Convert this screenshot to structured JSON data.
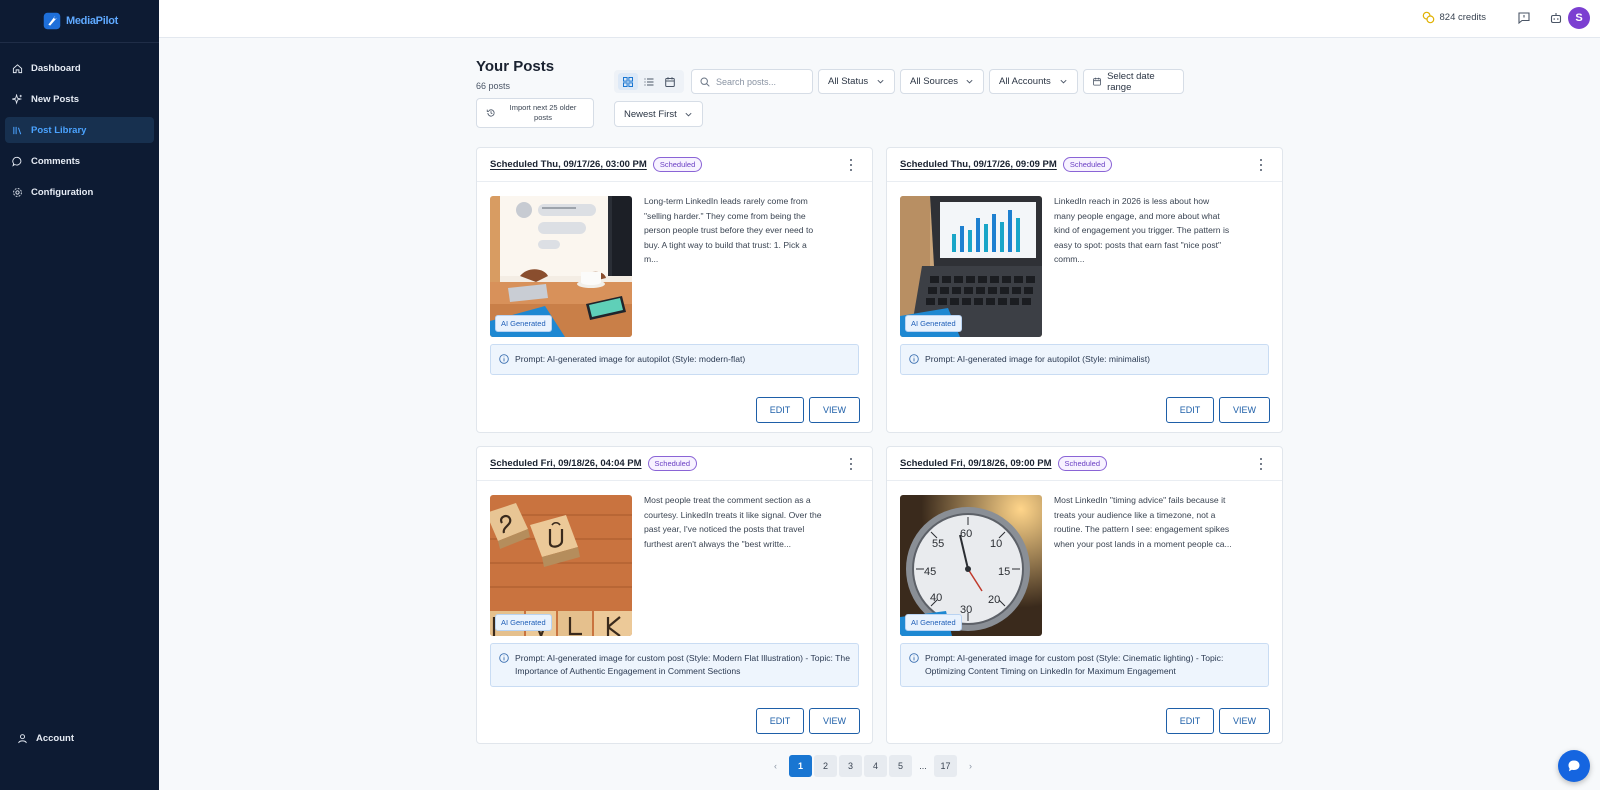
{
  "app": {
    "name": "MediaPilot",
    "accent": "#1976d2",
    "sidebar_bg": "#0d1b33"
  },
  "sidebar": {
    "items": [
      {
        "label": "Dashboard",
        "icon": "home-icon"
      },
      {
        "label": "New Posts",
        "icon": "sparkles-icon"
      },
      {
        "label": "Post Library",
        "icon": "library-icon",
        "active": true
      },
      {
        "label": "Comments",
        "icon": "comment-icon"
      },
      {
        "label": "Configuration",
        "icon": "gear-icon"
      }
    ],
    "account_label": "Account"
  },
  "topbar": {
    "credits": "824 credits",
    "avatar_initial": "S"
  },
  "header": {
    "title": "Your Posts",
    "count": "66 posts",
    "import_label": "Import next 25 older posts",
    "search_placeholder": "Search posts...",
    "status_filter": "All Status",
    "sources_filter": "All Sources",
    "accounts_filter": "All Accounts",
    "date_range": "Select date range",
    "sort": "Newest First"
  },
  "posts": [
    {
      "schedule": "Scheduled Thu, 09/17/26, 03:00 PM",
      "status": "Scheduled",
      "ai_badge": "AI Generated",
      "text": "Long-term LinkedIn leads rarely come from \"selling harder.\" They come from being the person people trust before they ever need to buy. A tight way to build that trust: 1. Pick a m...",
      "prompt": "Prompt: AI-generated image for autopilot (Style: modern-flat)",
      "edit": "EDIT",
      "view": "VIEW"
    },
    {
      "schedule": "Scheduled Thu, 09/17/26, 09:09 PM",
      "status": "Scheduled",
      "ai_badge": "AI Generated",
      "text": "LinkedIn reach in 2026 is less about how many people engage, and more about what kind of engagement you trigger. The pattern is easy to spot: posts that earn fast \"nice post\" comm...",
      "prompt": "Prompt: AI-generated image for autopilot (Style: minimalist)",
      "edit": "EDIT",
      "view": "VIEW"
    },
    {
      "schedule": "Scheduled Fri, 09/18/26, 04:04 PM",
      "status": "Scheduled",
      "ai_badge": "AI Generated",
      "text": "Most people treat the comment section as a courtesy. LinkedIn treats it like signal. Over the past year, I've noticed the posts that travel furthest aren't always the \"best writte...",
      "prompt": "Prompt: AI-generated image for custom post (Style: Modern Flat Illustration) - Topic: The Importance of Authentic Engagement in Comment Sections",
      "edit": "EDIT",
      "view": "VIEW"
    },
    {
      "schedule": "Scheduled Fri, 09/18/26, 09:00 PM",
      "status": "Scheduled",
      "ai_badge": "AI Generated",
      "text": "Most LinkedIn \"timing advice\" fails because it treats your audience like a timezone, not a routine. The pattern I see: engagement spikes when your post lands in a moment people ca...",
      "prompt": "Prompt: AI-generated image for custom post (Style: Cinematic lighting) - Topic: Optimizing Content Timing on LinkedIn for Maximum Engagement",
      "edit": "EDIT",
      "view": "VIEW"
    }
  ],
  "pagination": {
    "pages": [
      "1",
      "2",
      "3",
      "4",
      "5"
    ],
    "ellipsis": "...",
    "last": "17",
    "current": "1",
    "prev": "‹",
    "next": "›"
  }
}
